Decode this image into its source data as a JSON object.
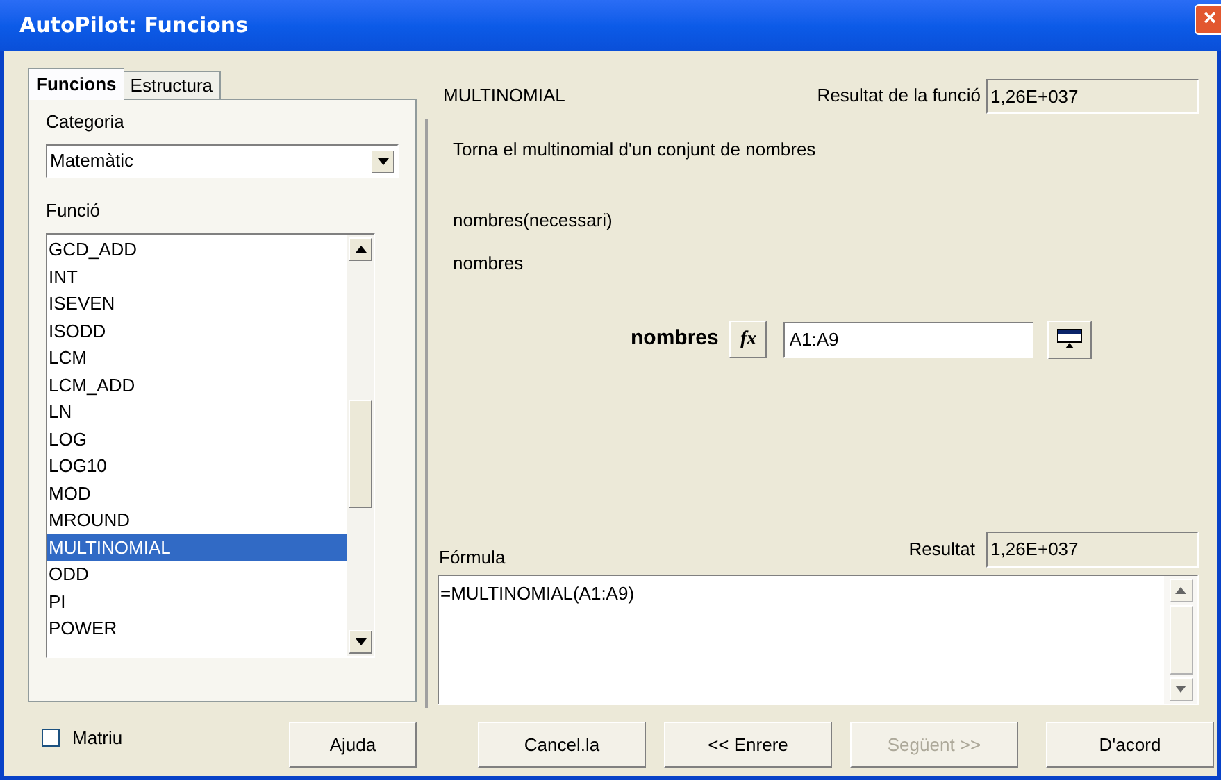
{
  "window": {
    "title": "AutoPilot: Funcions",
    "close": "×"
  },
  "tabs": [
    {
      "label": "Funcions",
      "selected": true
    },
    {
      "label": "Estructura",
      "selected": false
    }
  ],
  "category": {
    "label": "Categoria",
    "value": "Matemàtic"
  },
  "function_list": {
    "label": "Funció",
    "items": [
      {
        "label": "GCD_ADD",
        "selected": false
      },
      {
        "label": "INT",
        "selected": false
      },
      {
        "label": "ISEVEN",
        "selected": false
      },
      {
        "label": "ISODD",
        "selected": false
      },
      {
        "label": "LCM",
        "selected": false
      },
      {
        "label": "LCM_ADD",
        "selected": false
      },
      {
        "label": "LN",
        "selected": false
      },
      {
        "label": "LOG",
        "selected": false
      },
      {
        "label": "LOG10",
        "selected": false
      },
      {
        "label": "MOD",
        "selected": false
      },
      {
        "label": "MROUND",
        "selected": false
      },
      {
        "label": "MULTINOMIAL",
        "selected": true
      },
      {
        "label": "ODD",
        "selected": false
      },
      {
        "label": "PI",
        "selected": false
      },
      {
        "label": "POWER",
        "selected": false
      }
    ]
  },
  "function_name": "MULTINOMIAL",
  "function_result": {
    "label": "Resultat de la funció",
    "value": "1,26E+037"
  },
  "description": "Torna el multinomial d'un conjunt de nombres",
  "argument_info": [
    "nombres(necessari)",
    "nombres"
  ],
  "argument": {
    "label": "nombres",
    "fx": "fx",
    "value": "A1:A9"
  },
  "formula": {
    "label": "Fórmula",
    "value": "=MULTINOMIAL(A1:A9)"
  },
  "result": {
    "label": "Resultat",
    "value": "1,26E+037"
  },
  "array": {
    "label": "Matriu",
    "checked": false
  },
  "buttons": [
    {
      "label": "Ajuda",
      "disabled": false
    },
    {
      "label": "Cancel.la",
      "disabled": false
    },
    {
      "label": "<< Enrere",
      "disabled": false
    },
    {
      "label": "Següent >>",
      "disabled": true
    },
    {
      "label": "D'acord",
      "disabled": false
    }
  ]
}
